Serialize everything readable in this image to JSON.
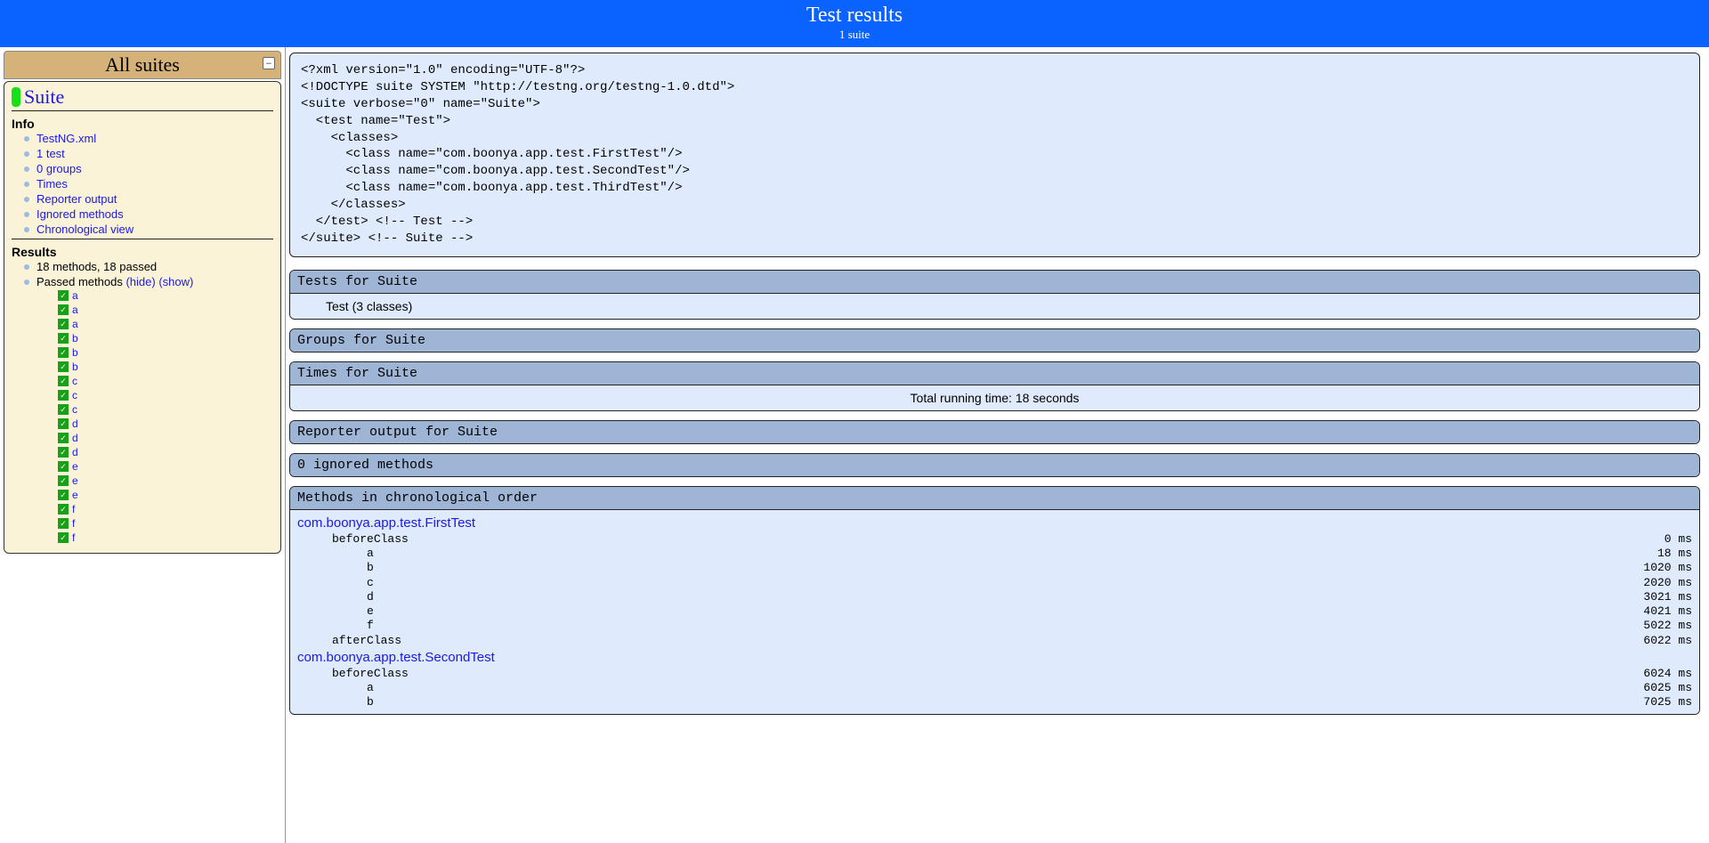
{
  "header": {
    "title": "Test results",
    "subtitle": "1 suite"
  },
  "left": {
    "all_suites": "All suites",
    "suite_name": "Suite",
    "info_label": "Info",
    "info_items": [
      "TestNG.xml",
      "1 test",
      "0 groups",
      "Times",
      "Reporter output",
      "Ignored methods",
      "Chronological view"
    ],
    "results_label": "Results",
    "results_summary": "18 methods, 18 passed",
    "passed_methods_label": "Passed methods",
    "hide_label": "(hide)",
    "show_label": "(show)",
    "methods": [
      "a",
      "a",
      "a",
      "b",
      "b",
      "b",
      "c",
      "c",
      "c",
      "d",
      "d",
      "d",
      "e",
      "e",
      "e",
      "f",
      "f",
      "f"
    ]
  },
  "right": {
    "xml": "<?xml version=\"1.0\" encoding=\"UTF-8\"?>\n<!DOCTYPE suite SYSTEM \"http://testng.org/testng-1.0.dtd\">\n<suite verbose=\"0\" name=\"Suite\">\n  <test name=\"Test\">\n    <classes>\n      <class name=\"com.boonya.app.test.FirstTest\"/>\n      <class name=\"com.boonya.app.test.SecondTest\"/>\n      <class name=\"com.boonya.app.test.ThirdTest\"/>\n    </classes>\n  </test> <!-- Test -->\n</suite> <!-- Suite -->",
    "tests_head": "Tests for Suite",
    "tests_body": "Test (3 classes)",
    "groups_head": "Groups for Suite",
    "times_head": "Times for Suite",
    "times_body": "Total running time: 18 seconds",
    "reporter_head": "Reporter output for Suite",
    "ignored_head": "0 ignored methods",
    "chrono_head": "Methods in chronological order",
    "chrono": [
      {
        "class": "com.boonya.app.test.FirstTest",
        "rows": [
          {
            "name": "beforeClass",
            "indent": 1,
            "time": "0 ms"
          },
          {
            "name": "a",
            "indent": 2,
            "time": "18 ms"
          },
          {
            "name": "b",
            "indent": 2,
            "time": "1020 ms"
          },
          {
            "name": "c",
            "indent": 2,
            "time": "2020 ms"
          },
          {
            "name": "d",
            "indent": 2,
            "time": "3021 ms"
          },
          {
            "name": "e",
            "indent": 2,
            "time": "4021 ms"
          },
          {
            "name": "f",
            "indent": 2,
            "time": "5022 ms"
          },
          {
            "name": "afterClass",
            "indent": 1,
            "time": "6022 ms"
          }
        ]
      },
      {
        "class": "com.boonya.app.test.SecondTest",
        "rows": [
          {
            "name": "beforeClass",
            "indent": 1,
            "time": "6024 ms"
          },
          {
            "name": "a",
            "indent": 2,
            "time": "6025 ms"
          },
          {
            "name": "b",
            "indent": 2,
            "time": "7025 ms"
          }
        ]
      }
    ]
  }
}
